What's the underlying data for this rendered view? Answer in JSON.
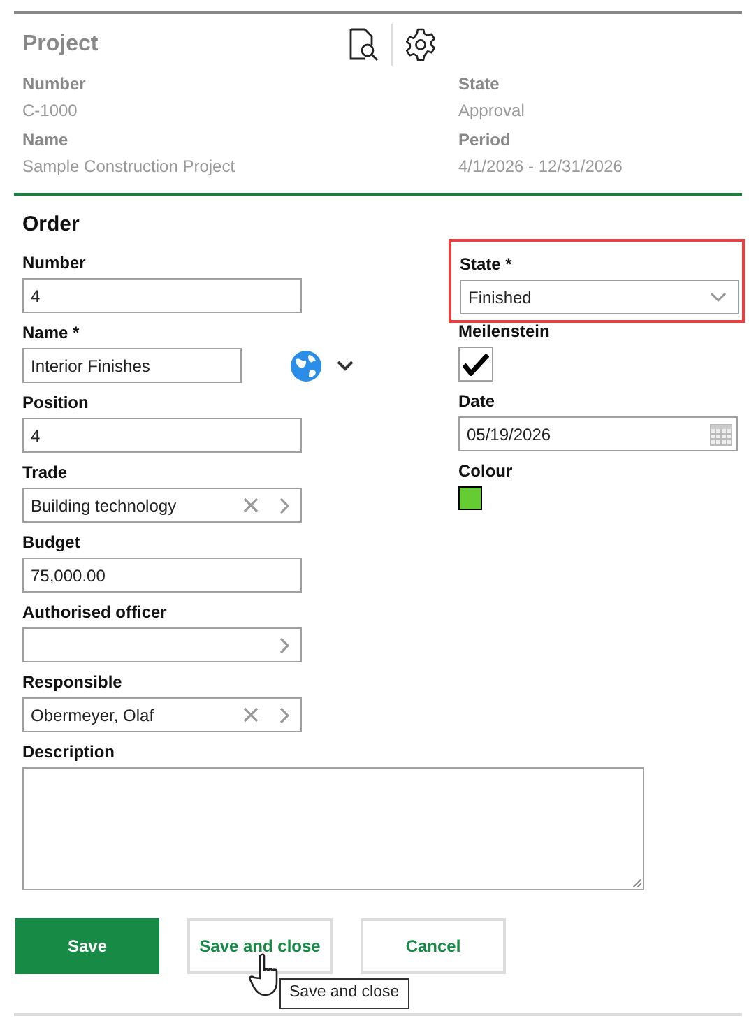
{
  "project": {
    "title": "Project",
    "fields": [
      {
        "label": "Number",
        "value": "C-1000"
      },
      {
        "label": "State",
        "value": "Approval"
      },
      {
        "label": "Name",
        "value": "Sample Construction Project"
      },
      {
        "label": "Period",
        "value": "4/1/2026 - 12/31/2026"
      }
    ]
  },
  "order": {
    "title": "Order",
    "left_fields": [
      {
        "kind": "text",
        "label": "Number",
        "value": "4"
      },
      {
        "kind": "translatable",
        "label": "Name *",
        "value": "Interior Finishes"
      },
      {
        "kind": "text",
        "label": "Position",
        "value": "4"
      },
      {
        "kind": "lookup",
        "label": "Trade",
        "value": "Building technology",
        "clearable": true
      },
      {
        "kind": "text",
        "label": "Budget",
        "value": "75,000.00"
      },
      {
        "kind": "lookup",
        "label": "Authorised officer",
        "clearable": false
      },
      {
        "kind": "lookup",
        "label": "Responsible",
        "value": "Obermeyer, Olaf",
        "clearable": true
      },
      {
        "kind": "textarea",
        "label": "Description"
      }
    ],
    "right_fields": [
      {
        "kind": "select",
        "label": "State *",
        "value": "Finished",
        "highlighted": true
      },
      {
        "kind": "checkbox",
        "label": "Meilenstein",
        "checked": true
      },
      {
        "kind": "date",
        "label": "Date",
        "value": "05/19/2026"
      },
      {
        "kind": "color",
        "label": "Colour",
        "color": "#66cc33"
      }
    ]
  },
  "buttons": [
    {
      "label": "Save",
      "primary": true
    },
    {
      "label": "Save and close",
      "primary": false
    },
    {
      "label": "Cancel",
      "primary": false
    }
  ],
  "tooltip": "Save and close"
}
